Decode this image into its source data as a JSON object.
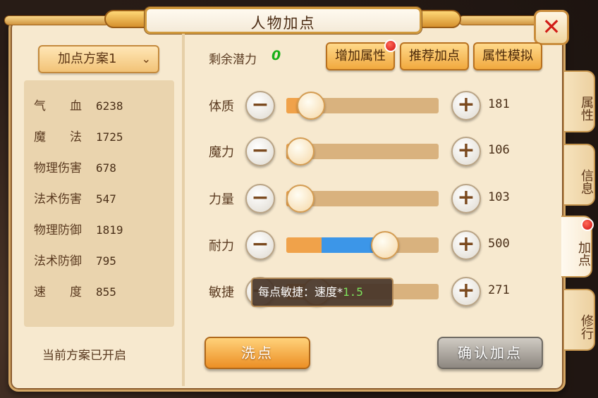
{
  "window": {
    "title": "人物加点",
    "close_icon": "close-icon"
  },
  "left": {
    "scheme_label": "加点方案1",
    "stats": [
      {
        "label": "气　　血",
        "value": "6238"
      },
      {
        "label": "魔　　法",
        "value": "1725"
      },
      {
        "label": "物理伤害",
        "value": "678"
      },
      {
        "label": "法术伤害",
        "value": "547"
      },
      {
        "label": "物理防御",
        "value": "1819"
      },
      {
        "label": "法术防御",
        "value": "795"
      },
      {
        "label": "速　　度",
        "value": "855"
      }
    ],
    "status": "当前方案已开启"
  },
  "remaining": {
    "label": "剩余潜力",
    "value": "0"
  },
  "top_buttons": {
    "add": "增加属性",
    "recommend": "推荐加点",
    "simulate": "属性模拟"
  },
  "attributes": [
    {
      "name": "体质",
      "value": "181",
      "base_fraction": 0.16,
      "add_fraction": 0.0
    },
    {
      "name": "魔力",
      "value": "106",
      "base_fraction": 0.06,
      "add_fraction": 0.0
    },
    {
      "name": "力量",
      "value": "103",
      "base_fraction": 0.06,
      "add_fraction": 0.0
    },
    {
      "name": "耐力",
      "value": "500",
      "base_fraction": 0.23,
      "add_fraction": 0.42
    },
    {
      "name": "敏捷",
      "value": "271",
      "base_fraction": 0.2,
      "add_fraction": 0.0
    }
  ],
  "tooltip": {
    "text": "每点敏捷：速度*",
    "number": "1.5"
  },
  "bottom": {
    "wash": "洗点",
    "confirm": "确认加点"
  },
  "tabs": [
    "属性",
    "信息",
    "加点",
    "修行"
  ],
  "colors": {
    "accent": "#f1a93f",
    "add_bar": "#3c96e8",
    "remaining": "#18b018",
    "alert": "#d10f0f"
  }
}
